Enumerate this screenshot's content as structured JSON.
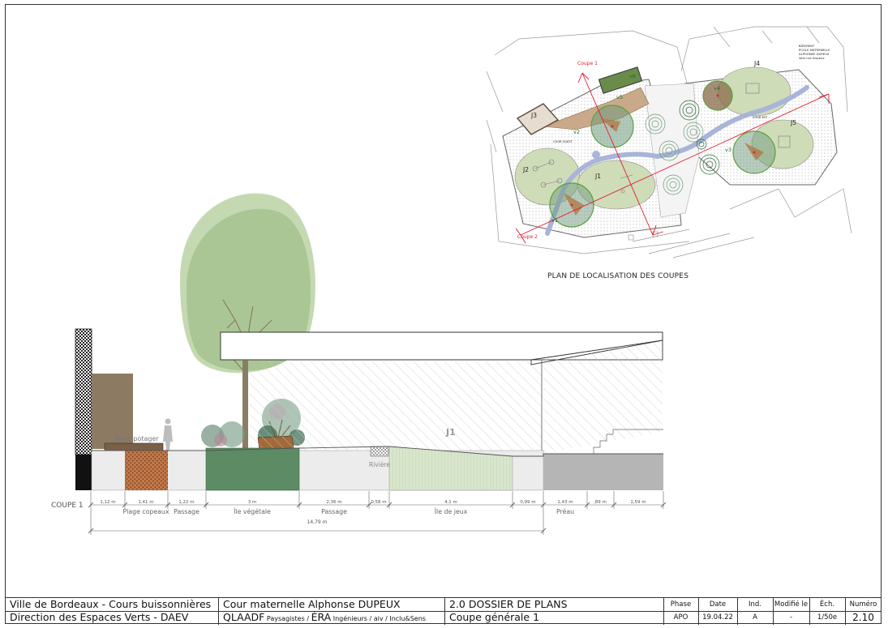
{
  "plan": {
    "title": "PLAN DE LOCALISATION DES COUPES",
    "building_note": [
      "BÂTIMENT",
      "ÉCOLE MATERNELLE",
      "ALPHONSE DUPEUX",
      "Vers rue Dupeux"
    ],
    "cut_labels": [
      "Coupe 1",
      "Coupe 2"
    ],
    "zone_labels": [
      "J1",
      "J2",
      "J3",
      "J4",
      "J5"
    ],
    "veg_labels": [
      "v1",
      "v2",
      "v3",
      "v4",
      "v5",
      "v6"
    ],
    "courtyards": [
      "COUR OUEST",
      "COUR EST"
    ]
  },
  "section": {
    "name": "COUPE 1",
    "zone_marker": "J1",
    "labels": {
      "bench": "Banc potager",
      "river": "Rivière"
    },
    "segments": [
      {
        "dim": "1,12 m",
        "label": ""
      },
      {
        "dim": "1,41 m",
        "label": "Plage copeaux"
      },
      {
        "dim": "1,22 m",
        "label": "Passage"
      },
      {
        "dim": "3 m",
        "label": "Île végétale"
      },
      {
        "dim": "2,36 m",
        "label": "Passage"
      },
      {
        "dim": "0,58 m",
        "label": ""
      },
      {
        "dim": "4,1 m",
        "label": "Île de jeux"
      },
      {
        "dim": "0,99 m",
        "label": ""
      },
      {
        "dim": "1,43 m",
        "label": "Préau"
      },
      {
        "dim": ",89 m",
        "label": ""
      },
      {
        "dim": "1,59 m",
        "label": ""
      }
    ],
    "total_dim": "14,79 m"
  },
  "titleblock": {
    "client1": "Ville de Bordeaux - Cours buissonnières",
    "client2": "Direction des Espaces Verts - DAEV",
    "project": "Cour maternelle Alphonse DUPEUX",
    "team_a": "QLAADF",
    "team_b": " Paysagistes / ",
    "team_c": "ÉRA",
    "team_d": " Ingénieurs / aiv / Inclu&Sens",
    "dossier": "2.0 DOSSIER DE PLANS",
    "sheet": "Coupe générale 1",
    "headers": [
      "Phase",
      "Date",
      "Ind.",
      "Modifié le",
      "Éch.",
      "Numéro"
    ],
    "values": [
      "APO",
      "19.04.22",
      "A",
      "-",
      "1/50e",
      "2.10"
    ]
  }
}
